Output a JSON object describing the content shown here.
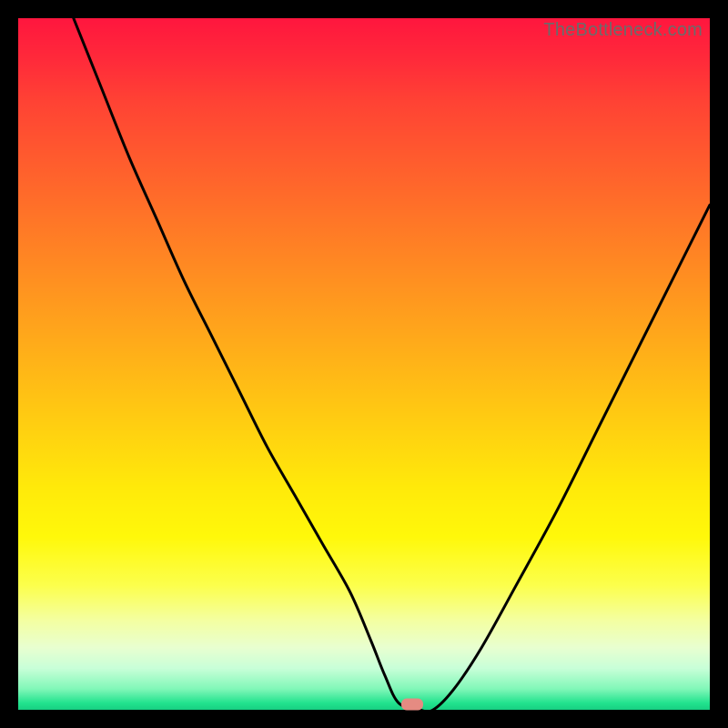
{
  "watermark": "TheBottleneck.com",
  "marker": {
    "x_pct": 57,
    "y_pct": 99.2,
    "color": "#e58b82"
  },
  "chart_data": {
    "type": "line",
    "title": "",
    "xlabel": "",
    "ylabel": "",
    "xlim": [
      0,
      100
    ],
    "ylim": [
      0,
      100
    ],
    "grid": false,
    "annotations": [
      "TheBottleneck.com"
    ],
    "series": [
      {
        "name": "bottleneck-curve",
        "x": [
          8,
          12,
          16,
          20,
          24,
          28,
          32,
          36,
          40,
          44,
          48,
          51,
          53,
          55,
          58,
          60,
          63,
          67,
          72,
          78,
          84,
          90,
          96,
          100
        ],
        "y": [
          100,
          90,
          80,
          71,
          62,
          54,
          46,
          38,
          31,
          24,
          17,
          10,
          5,
          1,
          0,
          0,
          3,
          9,
          18,
          29,
          41,
          53,
          65,
          73
        ]
      }
    ],
    "marker": {
      "x": 57,
      "y": 0
    }
  }
}
